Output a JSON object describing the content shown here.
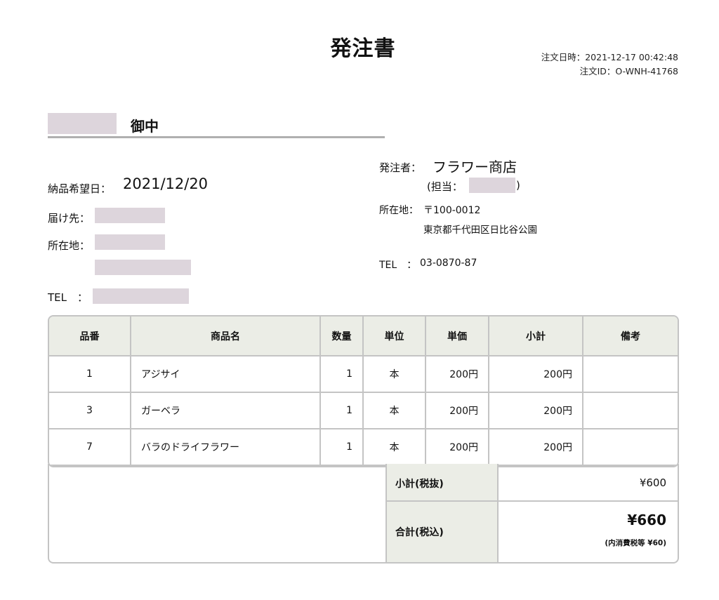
{
  "header": {
    "title": "発注書",
    "order_datetime": "注文日時：2021-12-17 00:42:48",
    "order_id": "注文ID：O-WNH-41768"
  },
  "recipient": {
    "suffix": "御中"
  },
  "delivery": {
    "label": "納品希望日：",
    "date": "2021/12/20"
  },
  "destination": {
    "ship_to_label": "届け先：",
    "address_label": "所在地：",
    "tel_label": "TEL　："
  },
  "sender": {
    "label": "発注者：",
    "name": "フラワー商店",
    "contact_open": "(担当：",
    "contact_close": ")",
    "address_label": "所在地：",
    "postal": "〒100-0012",
    "address": "東京都千代田区日比谷公園",
    "tel_label": "TEL　：",
    "tel": "03-0870-87"
  },
  "table": {
    "headers": [
      "品番",
      "商品名",
      "数量",
      "単位",
      "単価",
      "小計",
      "備考"
    ],
    "rows": [
      {
        "no": "1",
        "name": "アジサイ",
        "qty": "1",
        "unit": "本",
        "price": "200円",
        "subtotal": "200円",
        "note": ""
      },
      {
        "no": "3",
        "name": "ガーベラ",
        "qty": "1",
        "unit": "本",
        "price": "200円",
        "subtotal": "200円",
        "note": ""
      },
      {
        "no": "7",
        "name": "バラのドライフラワー",
        "qty": "1",
        "unit": "本",
        "price": "200円",
        "subtotal": "200円",
        "note": ""
      }
    ]
  },
  "summary": {
    "subtotal_label": "小計(税抜)",
    "subtotal_value": "¥600",
    "total_label": "合計(税込)",
    "total_value": "¥660",
    "tax_note": "(内消費税等 ¥60)"
  },
  "colors": {
    "redaction": "#ddd5dc",
    "header_bg": "#ebede6",
    "border": "#c4c4c4"
  }
}
